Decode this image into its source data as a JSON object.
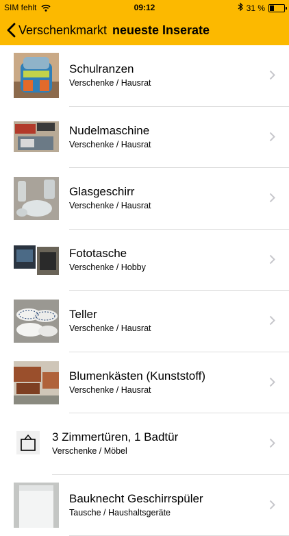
{
  "status": {
    "carrier": "SIM fehlt",
    "time": "09:12",
    "battery": "31 %",
    "battery_level": 0.31
  },
  "nav": {
    "back_label": "Verschenkmarkt",
    "title": "neueste Inserate"
  },
  "listings": [
    {
      "title": "Schulranzen",
      "subtitle": "Verschenke / Hausrat"
    },
    {
      "title": "Nudelmaschine",
      "subtitle": "Verschenke / Hausrat"
    },
    {
      "title": "Glasgeschirr",
      "subtitle": "Verschenke / Hausrat"
    },
    {
      "title": "Fototasche",
      "subtitle": "Verschenke / Hobby"
    },
    {
      "title": "Teller",
      "subtitle": "Verschenke / Hausrat"
    },
    {
      "title": "Blumenkästen (Kunststoff)",
      "subtitle": "Verschenke / Hausrat"
    },
    {
      "title": "3 Zimmertüren, 1 Badtür",
      "subtitle": "Verschenke / Möbel"
    },
    {
      "title": "Bauknecht Geschirrspüler",
      "subtitle": "Tausche / Haushaltsgeräte"
    }
  ],
  "icons": {
    "back": "chevron-left-icon",
    "wifi": "wifi-icon",
    "bluetooth": "bluetooth-icon",
    "battery": "battery-icon",
    "disclosure": "chevron-right-icon",
    "placeholder": "image-placeholder-icon"
  },
  "colors": {
    "bar": "#fcb900",
    "separator": "#dcdcdc",
    "chevron": "#c7c7cc"
  }
}
